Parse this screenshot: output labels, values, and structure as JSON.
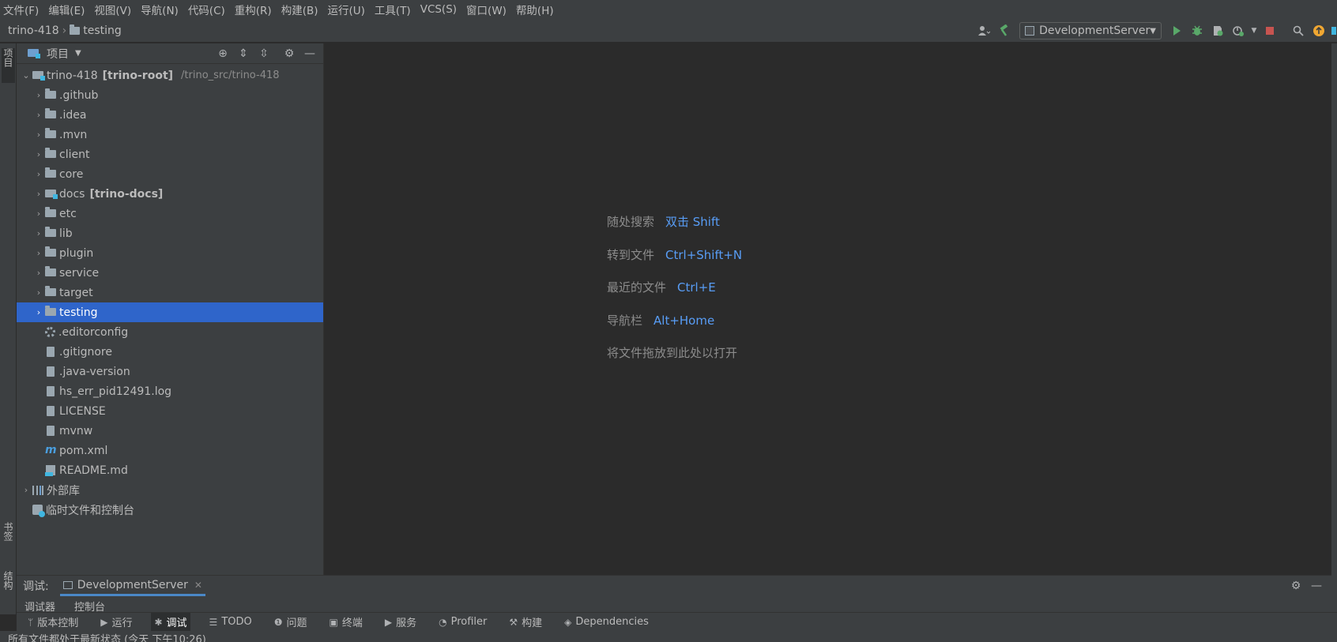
{
  "menu": [
    "文件(F)",
    "编辑(E)",
    "视图(V)",
    "导航(N)",
    "代码(C)",
    "重构(R)",
    "构建(B)",
    "运行(U)",
    "工具(T)",
    "VCS(S)",
    "窗口(W)",
    "帮助(H)"
  ],
  "breadcrumb": {
    "project": "trino-418",
    "folder": "testing"
  },
  "toolbar": {
    "run_config": "DevelopmentServer"
  },
  "left_strip": {
    "project_tab": "项目",
    "bookmarks_tab": "书签",
    "structure_tab": "结构"
  },
  "project_panel": {
    "title": "项目",
    "root": {
      "name": "trino-418",
      "module": "[trino-root]",
      "path": "/trino_src/trino-418"
    },
    "items": [
      {
        "name": ".github",
        "kind": "folder",
        "expandable": true,
        "selected": false
      },
      {
        "name": ".idea",
        "kind": "folder",
        "expandable": true,
        "selected": false
      },
      {
        "name": ".mvn",
        "kind": "folder",
        "expandable": true,
        "selected": false
      },
      {
        "name": "client",
        "kind": "folder",
        "expandable": true,
        "selected": false
      },
      {
        "name": "core",
        "kind": "folder",
        "expandable": true,
        "selected": false
      },
      {
        "name": "docs",
        "kind": "module",
        "module": "[trino-docs]",
        "expandable": true,
        "selected": false
      },
      {
        "name": "etc",
        "kind": "folder",
        "expandable": true,
        "selected": false
      },
      {
        "name": "lib",
        "kind": "folder",
        "expandable": true,
        "selected": false
      },
      {
        "name": "plugin",
        "kind": "folder",
        "expandable": true,
        "selected": false
      },
      {
        "name": "service",
        "kind": "folder",
        "expandable": true,
        "selected": false
      },
      {
        "name": "target",
        "kind": "folder",
        "expandable": true,
        "selected": false
      },
      {
        "name": "testing",
        "kind": "folder",
        "expandable": true,
        "selected": true
      },
      {
        "name": ".editorconfig",
        "kind": "gear",
        "expandable": false,
        "selected": false
      },
      {
        "name": ".gitignore",
        "kind": "file",
        "expandable": false,
        "selected": false
      },
      {
        "name": ".java-version",
        "kind": "file",
        "expandable": false,
        "selected": false
      },
      {
        "name": "hs_err_pid12491.log",
        "kind": "file",
        "expandable": false,
        "selected": false
      },
      {
        "name": "LICENSE",
        "kind": "file",
        "expandable": false,
        "selected": false
      },
      {
        "name": "mvnw",
        "kind": "file",
        "expandable": false,
        "selected": false
      },
      {
        "name": "pom.xml",
        "kind": "mvn",
        "expandable": false,
        "selected": false
      },
      {
        "name": "README.md",
        "kind": "md",
        "expandable": false,
        "selected": false
      }
    ],
    "external_libs": "外部库",
    "scratches": "临时文件和控制台"
  },
  "editor_hints": [
    {
      "label": "随处搜索",
      "key": "双击 Shift"
    },
    {
      "label": "转到文件",
      "key": "Ctrl+Shift+N"
    },
    {
      "label": "最近的文件",
      "key": "Ctrl+E"
    },
    {
      "label": "导航栏",
      "key": "Alt+Home"
    },
    {
      "label": "将文件拖放到此处以打开",
      "key": ""
    }
  ],
  "debug_panel": {
    "label": "调试:",
    "tab": "DevelopmentServer",
    "sub_tabs": [
      "调试器",
      "控制台"
    ]
  },
  "bottom_tabs": [
    {
      "label": "版本控制",
      "icon": "branch-icon"
    },
    {
      "label": "运行",
      "icon": "run-icon"
    },
    {
      "label": "调试",
      "icon": "bug-icon"
    },
    {
      "label": "TODO",
      "icon": "list-icon"
    },
    {
      "label": "问题",
      "icon": "info-icon"
    },
    {
      "label": "终端",
      "icon": "terminal-icon"
    },
    {
      "label": "服务",
      "icon": "services-icon"
    },
    {
      "label": "Profiler",
      "icon": "profiler-icon"
    },
    {
      "label": "构建",
      "icon": "hammer-icon"
    },
    {
      "label": "Dependencies",
      "icon": "dependencies-icon"
    }
  ],
  "active_bottom_tab": "调试",
  "status": "所有文件都处于最新状态 (今天 下午10:26)",
  "colors": {
    "selection": "#2f65ca",
    "link": "#589df6",
    "run_green": "#59a869",
    "stop_red": "#c75450",
    "update_orange": "#f0a732"
  }
}
